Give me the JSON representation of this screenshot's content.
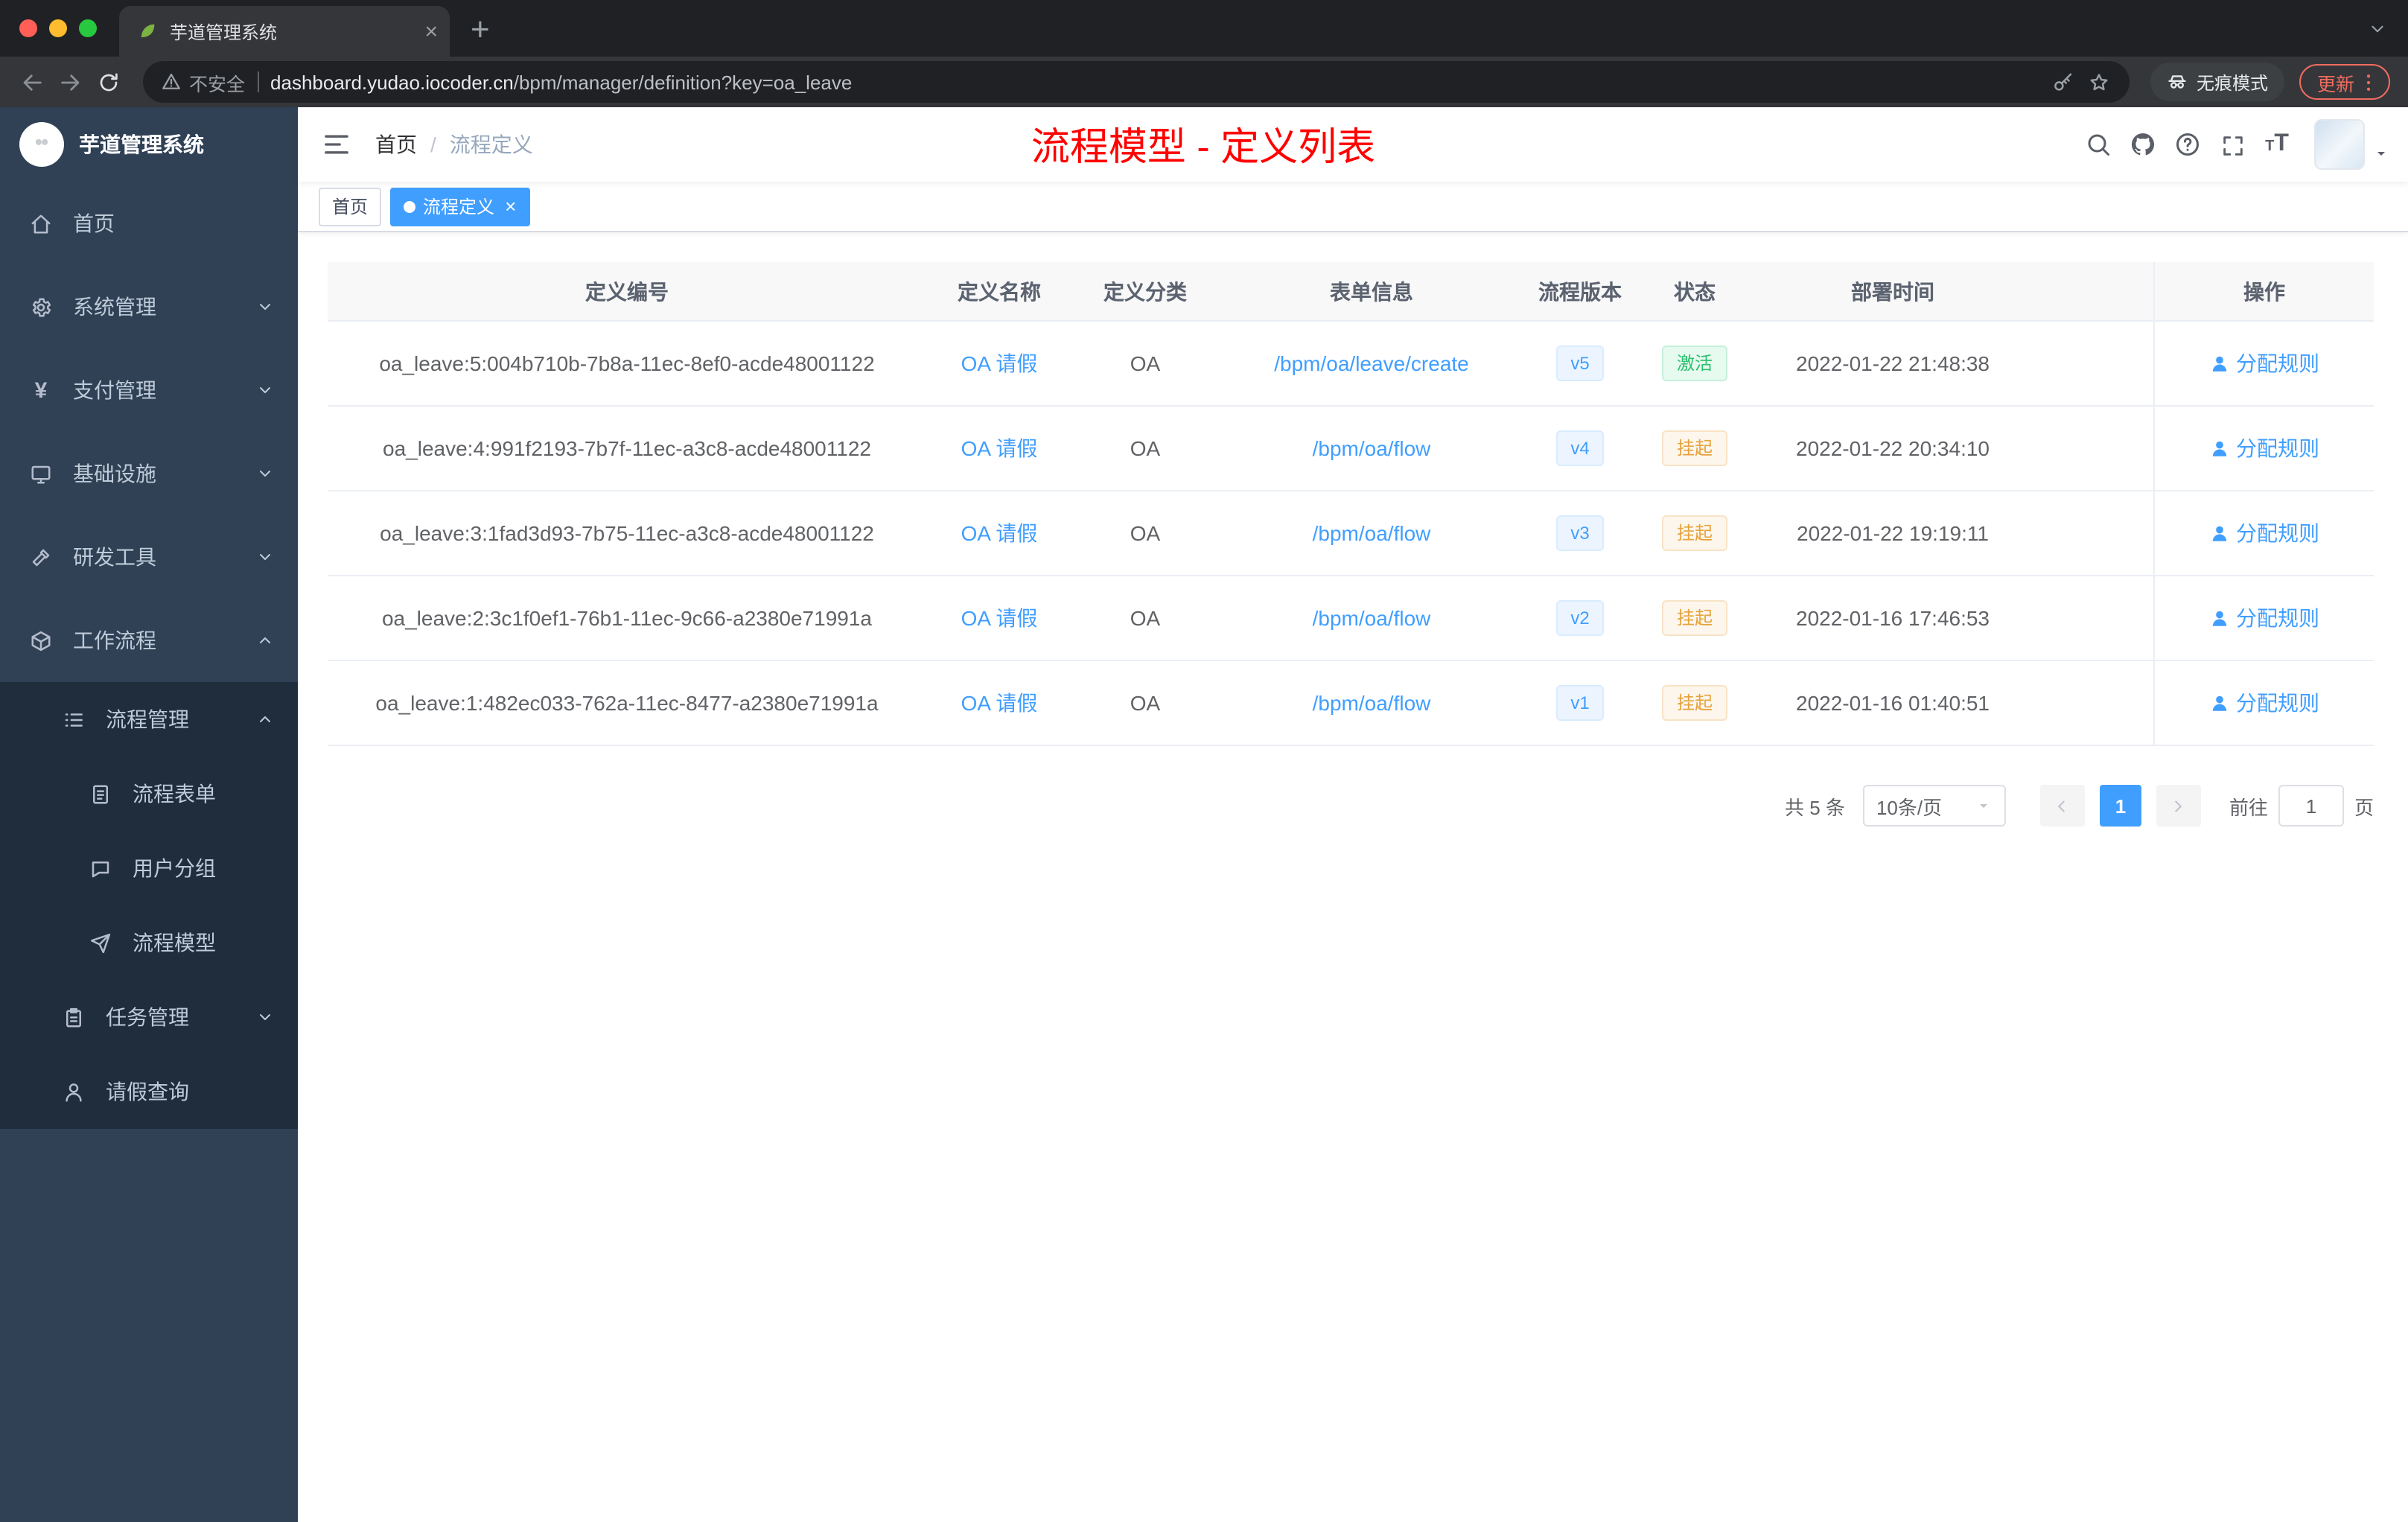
{
  "browser": {
    "tab_title": "芋道管理系统",
    "security_label": "不安全",
    "url_domain": "dashboard.yudao.iocoder.cn",
    "url_path": "/bpm/manager/definition?key=oa_leave",
    "incognito_label": "无痕模式",
    "update_label": "更新"
  },
  "sidebar": {
    "logo_title": "芋道管理系统",
    "items": [
      {
        "key": "home",
        "label": "首页",
        "icon": "home",
        "level": 0,
        "sub": false,
        "chevron": null
      },
      {
        "key": "system",
        "label": "系统管理",
        "icon": "gear",
        "level": 0,
        "sub": false,
        "chevron": "down"
      },
      {
        "key": "payment",
        "label": "支付管理",
        "icon": "yen",
        "level": 0,
        "sub": false,
        "chevron": "down"
      },
      {
        "key": "infra",
        "label": "基础设施",
        "icon": "monitor",
        "level": 0,
        "sub": false,
        "chevron": "down"
      },
      {
        "key": "devtools",
        "label": "研发工具",
        "icon": "tools",
        "level": 0,
        "sub": false,
        "chevron": "down"
      },
      {
        "key": "workflow",
        "label": "工作流程",
        "icon": "cube",
        "level": 0,
        "sub": false,
        "chevron": "up"
      },
      {
        "key": "process-mgmt",
        "label": "流程管理",
        "icon": "list",
        "level": 1,
        "sub": true,
        "chevron": "up"
      },
      {
        "key": "process-form",
        "label": "流程表单",
        "icon": "doc",
        "level": 2,
        "sub": true,
        "chevron": null
      },
      {
        "key": "user-group",
        "label": "用户分组",
        "icon": "chat",
        "level": 2,
        "sub": true,
        "chevron": null
      },
      {
        "key": "process-model",
        "label": "流程模型",
        "icon": "send",
        "level": 2,
        "sub": true,
        "chevron": null
      },
      {
        "key": "task-mgmt",
        "label": "任务管理",
        "icon": "clipboard",
        "level": 1,
        "sub": true,
        "chevron": "down"
      },
      {
        "key": "leave-query",
        "label": "请假查询",
        "icon": "person",
        "level": 1,
        "sub": true,
        "chevron": null
      }
    ]
  },
  "header": {
    "breadcrumb_home": "首页",
    "breadcrumb_separator": "/",
    "breadcrumb_current": "流程定义",
    "page_title": "流程模型 - 定义列表"
  },
  "tags": [
    {
      "key": "home",
      "label": "首页",
      "active": false,
      "closable": false
    },
    {
      "key": "process-definition",
      "label": "流程定义",
      "active": true,
      "closable": true
    }
  ],
  "table": {
    "columns": [
      "定义编号",
      "定义名称",
      "定义分类",
      "表单信息",
      "流程版本",
      "状态",
      "部署时间",
      "操作"
    ],
    "rows": [
      {
        "id": "oa_leave:5:004b710b-7b8a-11ec-8ef0-acde48001122",
        "name": "OA 请假",
        "category": "OA",
        "form": "/bpm/oa/leave/create",
        "version": "v5",
        "status": "激活",
        "status_type": "success",
        "deploy_time": "2022-01-22 21:48:38",
        "action": "分配规则"
      },
      {
        "id": "oa_leave:4:991f2193-7b7f-11ec-a3c8-acde48001122",
        "name": "OA 请假",
        "category": "OA",
        "form": "/bpm/oa/flow",
        "version": "v4",
        "status": "挂起",
        "status_type": "warning",
        "deploy_time": "2022-01-22 20:34:10",
        "action": "分配规则"
      },
      {
        "id": "oa_leave:3:1fad3d93-7b75-11ec-a3c8-acde48001122",
        "name": "OA 请假",
        "category": "OA",
        "form": "/bpm/oa/flow",
        "version": "v3",
        "status": "挂起",
        "status_type": "warning",
        "deploy_time": "2022-01-22 19:19:11",
        "action": "分配规则"
      },
      {
        "id": "oa_leave:2:3c1f0ef1-76b1-11ec-9c66-a2380e71991a",
        "name": "OA 请假",
        "category": "OA",
        "form": "/bpm/oa/flow",
        "version": "v2",
        "status": "挂起",
        "status_type": "warning",
        "deploy_time": "2022-01-16 17:46:53",
        "action": "分配规则"
      },
      {
        "id": "oa_leave:1:482ec033-762a-11ec-8477-a2380e71991a",
        "name": "OA 请假",
        "category": "OA",
        "form": "/bpm/oa/flow",
        "version": "v1",
        "status": "挂起",
        "status_type": "warning",
        "deploy_time": "2022-01-16 01:40:51",
        "action": "分配规则"
      }
    ]
  },
  "pagination": {
    "total": "共 5 条",
    "page_size": "10条/页",
    "current_page": "1",
    "goto_label": "前往",
    "goto_value": "1",
    "goto_suffix": "页"
  },
  "colors": {
    "accent": "#409eff",
    "title_red": "#ff0000",
    "success_text": "#2ac06d",
    "warning_text": "#e6a23c",
    "sidebar_bg": "#304156",
    "submenu_bg": "#1f2d3d",
    "active_tag_bg": "#409eff",
    "chrome_dark": "#202124",
    "chrome_toolbar": "#35363a",
    "update_red": "#ef6c5f"
  }
}
